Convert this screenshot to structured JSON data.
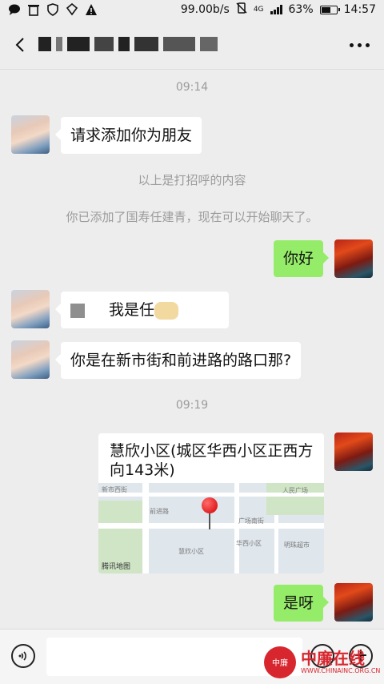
{
  "status_bar": {
    "speed": "99.00b/s",
    "network": "4G",
    "battery": "63%",
    "battery_level": 0.63,
    "time": "14:57"
  },
  "nav": {
    "back_icon": "back-arrow-icon",
    "more_icon": "more-icon"
  },
  "messages": {
    "ts1": "09:14",
    "m1": "请求添加你为朋友",
    "sys1": "以上是打招呼的内容",
    "sys2": "你已添加了国寿任建青，现在可以开始聊天了。",
    "m2": "你好",
    "m3": "我是任",
    "m4": "你是在新市街和前进路的路口那?",
    "ts2": "09:19",
    "m5_title": "慧欣小区(城区华西小区正西方向143米)",
    "m6": "是呀"
  },
  "map": {
    "labels": [
      "新市西街",
      "人民广场",
      "广场南街",
      "前进路",
      "华西小区",
      "慧欣小区",
      "明珠超市",
      "腾讯地图"
    ],
    "logo": "腾讯地图"
  },
  "input": {
    "placeholder": ""
  },
  "watermark": {
    "text": "中廉在线",
    "url": "WWW.CHINAINC.ORG.CN",
    "logo_text": "中廉"
  },
  "colors": {
    "bg": "#ededed",
    "bubble_right": "#95ec69",
    "bubble_left": "#ffffff"
  }
}
